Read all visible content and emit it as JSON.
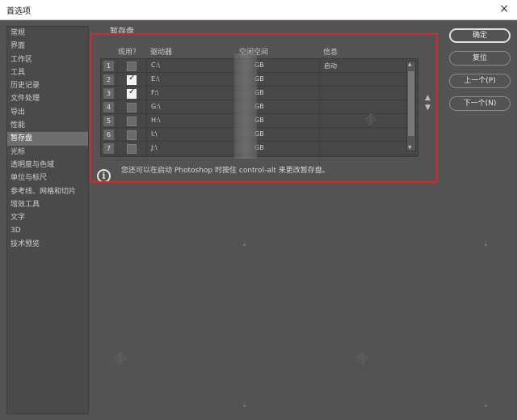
{
  "window": {
    "title": "首选项",
    "close_glyph": "×"
  },
  "sidebar": {
    "items": [
      {
        "label": "常规"
      },
      {
        "label": "界面"
      },
      {
        "label": "工作区"
      },
      {
        "label": "工具"
      },
      {
        "label": "历史记录"
      },
      {
        "label": "文件处理"
      },
      {
        "label": "导出"
      },
      {
        "label": "性能"
      },
      {
        "label": "暂存盘",
        "selected": true
      },
      {
        "label": "光标"
      },
      {
        "label": "透明度与色域"
      },
      {
        "label": "单位与标尺"
      },
      {
        "label": "参考线、网格和切片"
      },
      {
        "label": "增效工具"
      },
      {
        "label": "文字"
      },
      {
        "label": "3D"
      },
      {
        "label": "技术预览"
      }
    ]
  },
  "scratch": {
    "section_title": "暂存盘",
    "columns": {
      "active": "现用？",
      "drive": "驱动器",
      "free_space": "空闲空间",
      "info": "信息"
    },
    "rows": [
      {
        "num": "1",
        "active": false,
        "drive": "C:\\",
        "free": "GB",
        "info": "启动"
      },
      {
        "num": "2",
        "active": true,
        "drive": "E:\\",
        "free": "GB",
        "info": ""
      },
      {
        "num": "3",
        "active": true,
        "drive": "F:\\",
        "free": "GB",
        "info": ""
      },
      {
        "num": "4",
        "active": false,
        "drive": "G:\\",
        "free": "GB",
        "info": ""
      },
      {
        "num": "5",
        "active": false,
        "drive": "H:\\",
        "free": "GB",
        "info": ""
      },
      {
        "num": "6",
        "active": false,
        "drive": "I:\\",
        "free": "GB",
        "info": ""
      },
      {
        "num": "7",
        "active": false,
        "drive": "J:\\",
        "free": "GB",
        "info": ""
      }
    ],
    "info_note": "您还可以在启动 Photoshop 时按住 control-alt 来更改暂存盘。",
    "move_up_glyph": "▲",
    "move_down_glyph": "▼"
  },
  "buttons": {
    "ok": "确定",
    "reset": "复位",
    "prev": "上一个(P)",
    "next": "下一个(N)"
  },
  "colors": {
    "highlight_frame": "#d7262c",
    "panel_bg": "#535353"
  },
  "icons": {
    "info": "info-circle-icon",
    "checkbox": "checkmark-icon"
  }
}
